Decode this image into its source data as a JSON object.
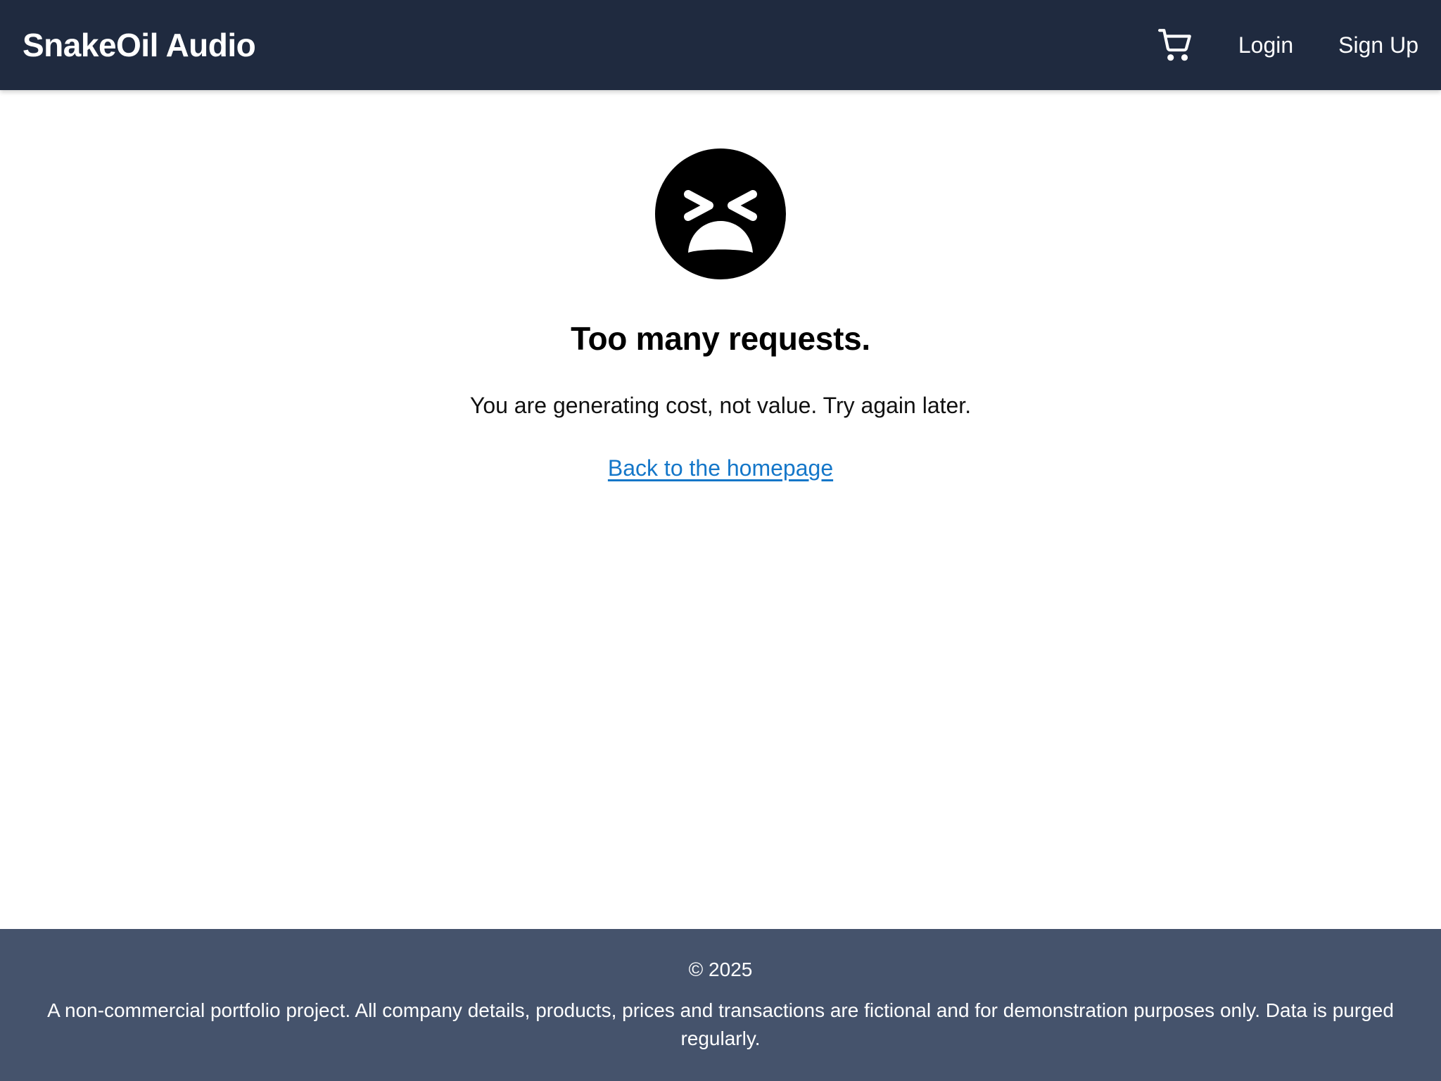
{
  "header": {
    "brand": "SnakeOil Audio",
    "cart_icon": "shopping-cart-icon",
    "login_label": "Login",
    "signup_label": "Sign Up",
    "background_color": "#1f2a3f"
  },
  "main": {
    "icon": "tired-face-icon",
    "headline": "Too many requests.",
    "message": "You are generating cost, not value. Try again later.",
    "home_link_label": "Back to the homepage",
    "link_color": "#1577c9"
  },
  "footer": {
    "copyright": "© 2025",
    "disclaimer": "A non-commercial portfolio project. All company details, products, prices and transactions are fictional and for demonstration purposes only. Data is purged regularly.",
    "background_color": "#45536c"
  }
}
